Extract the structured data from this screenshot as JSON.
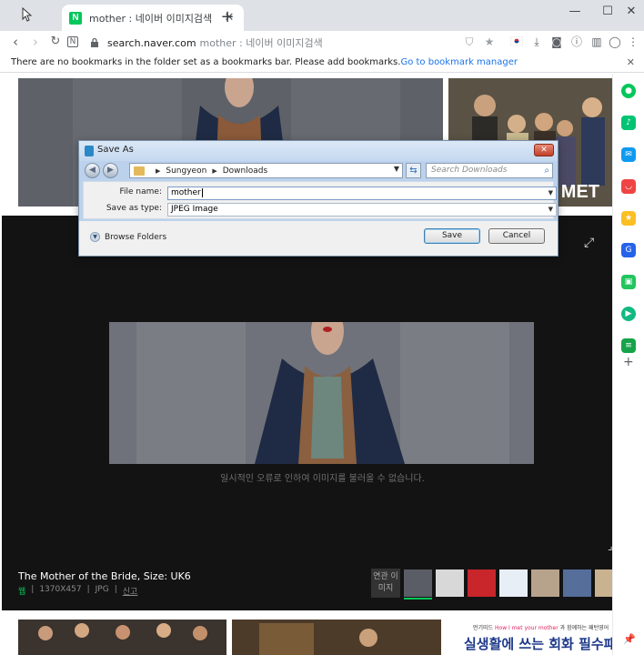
{
  "browser": {
    "tab_title": "mother : 네이버 이미지검색",
    "tab_favicon": "N",
    "new_tab_symbol": "+",
    "url_host": "search.naver.com",
    "url_rest": "mother : 네이버 이미지검색",
    "bookmarks_message": "There are no bookmarks in the folder set as a bookmarks bar. Please add bookmarks.",
    "bookmarks_link": "Go to bookmark manager",
    "accent_color": "#1a73e8"
  },
  "dialog": {
    "title": "Save As",
    "path": [
      "Sungyeon",
      "Downloads"
    ],
    "search_placeholder": "Search Downloads",
    "file_name_label": "File name:",
    "file_name_value": "mother",
    "save_type_label": "Save as type:",
    "save_type_value": "JPEG Image",
    "browse_folders": "Browse Folders",
    "save_button": "Save",
    "cancel_button": "Cancel"
  },
  "viewer": {
    "error_message": "일시적인 오류로 인하여 이미지를 불러올 수 없습니다.",
    "title": "The Mother of the Bride, Size: UK6",
    "meta_source": "웹",
    "meta_dimensions": "1370X457",
    "meta_format": "JPG",
    "meta_report": "신고",
    "related_label": "연관 이미지",
    "thumb_top_right_text": "MET"
  },
  "ad": {
    "small_prefix": "먼기미드",
    "small_highlight": "How I met your mother",
    "small_suffix": "과 함께하는 패턴영어",
    "headline": "실생활에 쓰는 회화 필수패턴"
  },
  "sidebar_colors": [
    "#03c75a",
    "#00c473",
    "#0f9af0",
    "#ef4444",
    "#fbbf24",
    "#2563eb",
    "#22c55e",
    "#10b981",
    "#16a34a"
  ]
}
